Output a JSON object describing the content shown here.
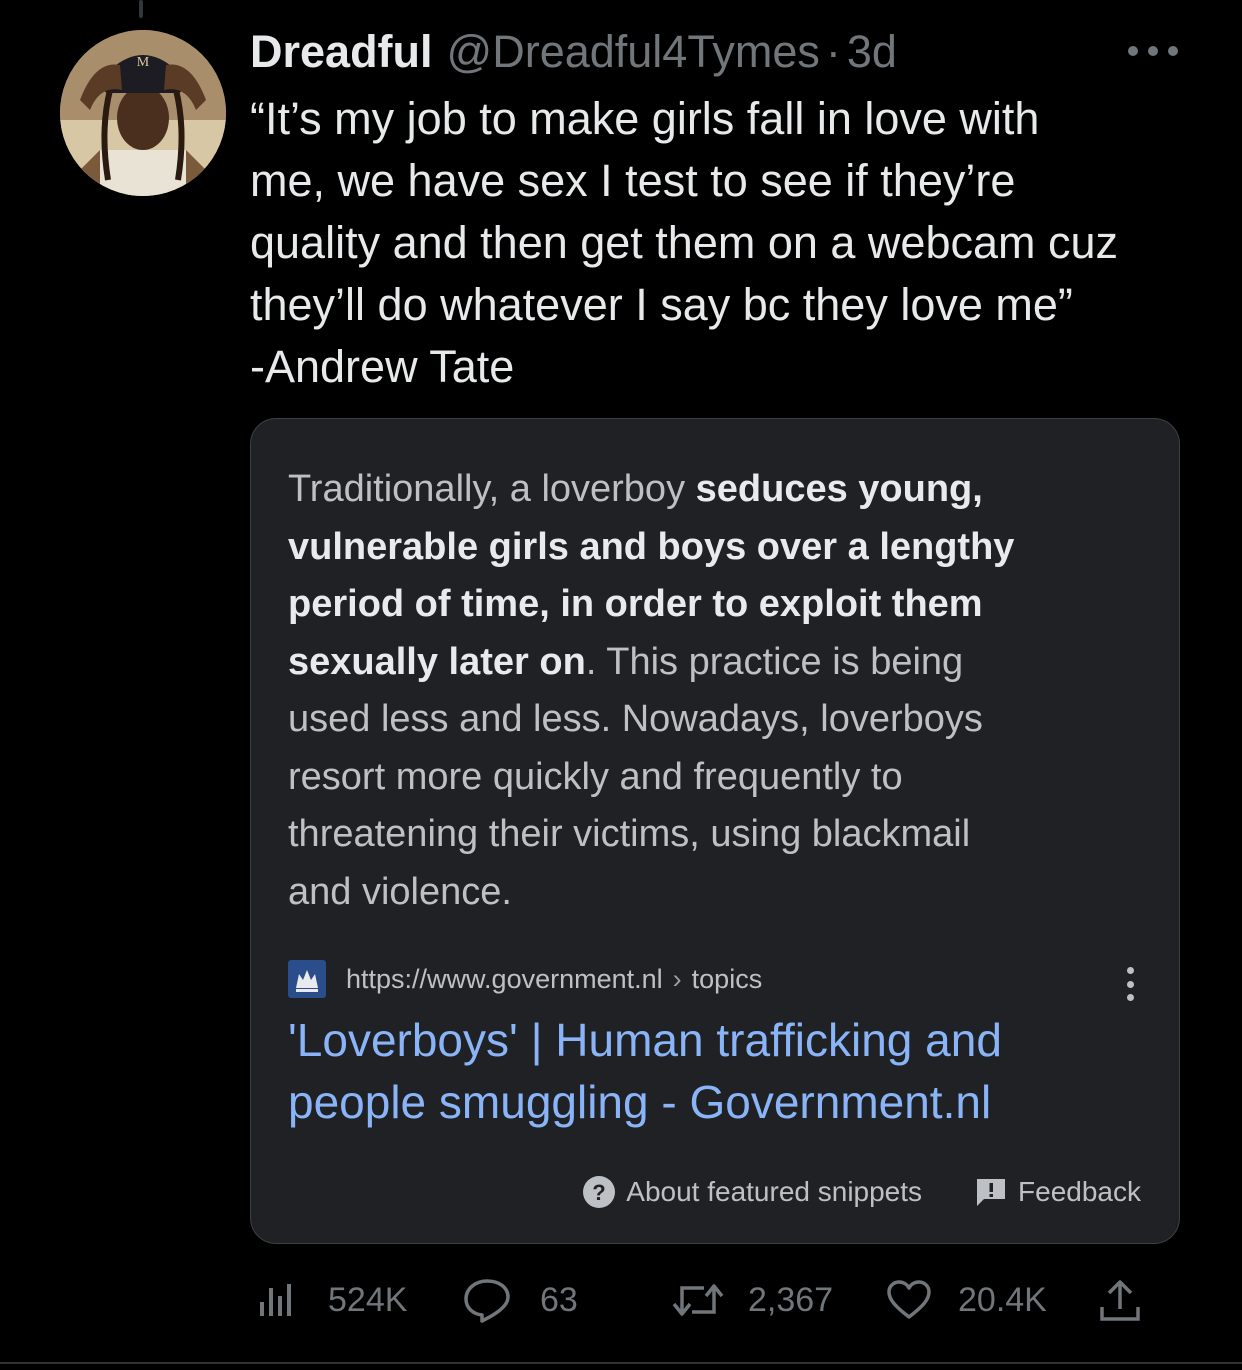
{
  "tweet": {
    "display_name": "Dreadful",
    "handle": "@Dreadful4Tymes",
    "separator": "·",
    "time": "3d",
    "text_lines": [
      "“It’s my job to make girls fall in love with",
      "me, we have sex I test to see if they’re",
      "quality and then get them on a webcam cuz",
      "they’ll do whatever I say bc they love me”",
      "-Andrew Tate"
    ]
  },
  "snippet_card": {
    "lines": [
      {
        "normal": "Traditionally, a loverboy ",
        "bold": "seduces young,",
        "after": ""
      },
      {
        "normal": "",
        "bold": "vulnerable girls and boys over a lengthy",
        "after": ""
      },
      {
        "normal": "",
        "bold": "period of time, in order to exploit them",
        "after": ""
      },
      {
        "normal": "",
        "bold": "sexually later on",
        "after": ". This practice is being"
      },
      {
        "normal": "used less and less. Nowadays, loverboys",
        "bold": "",
        "after": ""
      },
      {
        "normal": "resort more quickly and frequently to",
        "bold": "",
        "after": ""
      },
      {
        "normal": "threatening their victims, using blackmail",
        "bold": "",
        "after": ""
      },
      {
        "normal": "and violence.",
        "bold": "",
        "after": ""
      }
    ],
    "source_url": "https://www.government.nl",
    "url_separator": "›",
    "source_path": "topics",
    "result_title_lines": [
      "'Loverboys' | Human trafficking and",
      "people smuggling - Government.nl"
    ],
    "about_label": "About featured snippets",
    "feedback_label": "Feedback",
    "link_color": "#8ab4f8"
  },
  "actions": {
    "views": "524K",
    "replies": "63",
    "retweets": "2,367",
    "likes": "20.4K"
  },
  "icons": [
    "views-icon",
    "reply-icon",
    "retweet-icon",
    "like-icon",
    "share-icon",
    "more-icon",
    "favicon",
    "question-icon",
    "feedback-icon"
  ]
}
